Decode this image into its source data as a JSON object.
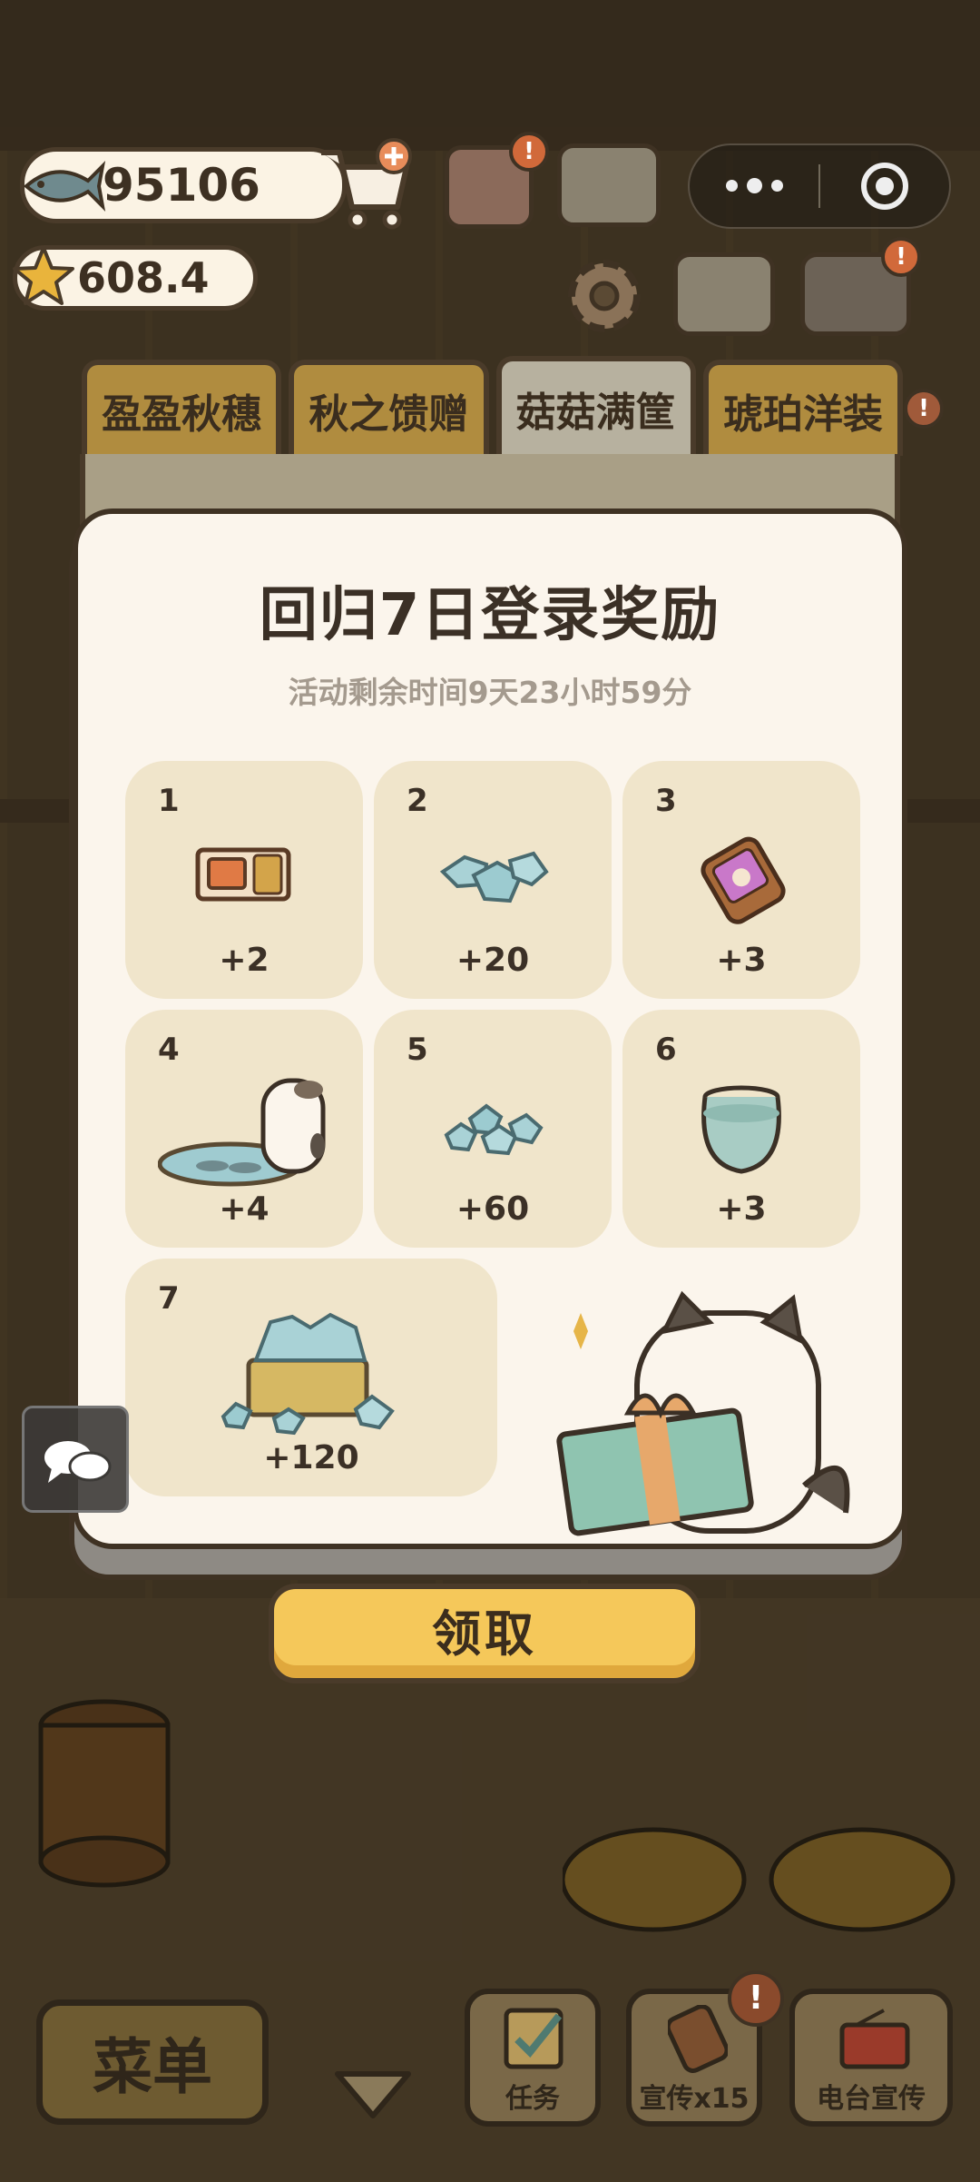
{
  "hud": {
    "fish_count": "95106",
    "star_count": "608.4"
  },
  "tabs": [
    {
      "label": "盈盈秋穗",
      "active": false
    },
    {
      "label": "秋之馈赠",
      "active": false
    },
    {
      "label": "菇菇满筐",
      "active": true
    },
    {
      "label": "琥珀洋装",
      "active": false
    }
  ],
  "modal": {
    "title": "回归7日登录奖励",
    "subtitle": "活动剩余时间9天23小时59分",
    "rewards": [
      {
        "day": "1",
        "amount": "+2",
        "icon": "tv-ticket-icon"
      },
      {
        "day": "2",
        "amount": "+20",
        "icon": "gems-icon"
      },
      {
        "day": "3",
        "amount": "+3",
        "icon": "promo-card-icon"
      },
      {
        "day": "4",
        "amount": "+4",
        "icon": "cat-fish-pond-icon"
      },
      {
        "day": "5",
        "amount": "+60",
        "icon": "gem-pile-icon"
      },
      {
        "day": "6",
        "amount": "+3",
        "icon": "glass-bowl-icon"
      },
      {
        "day": "7",
        "amount": "+120",
        "icon": "gem-basket-icon"
      }
    ],
    "claim_label": "领取"
  },
  "bottom_bar": {
    "menu_label": "菜单",
    "task_label": "任务",
    "promo_label": "宣传x15",
    "radio_label": "电台宣传"
  },
  "colors": {
    "card_bg": "#f0e5cb",
    "modal_bg": "#fbf5ec",
    "button_yellow": "#f5c85a",
    "alert_orange": "#d1693a"
  }
}
